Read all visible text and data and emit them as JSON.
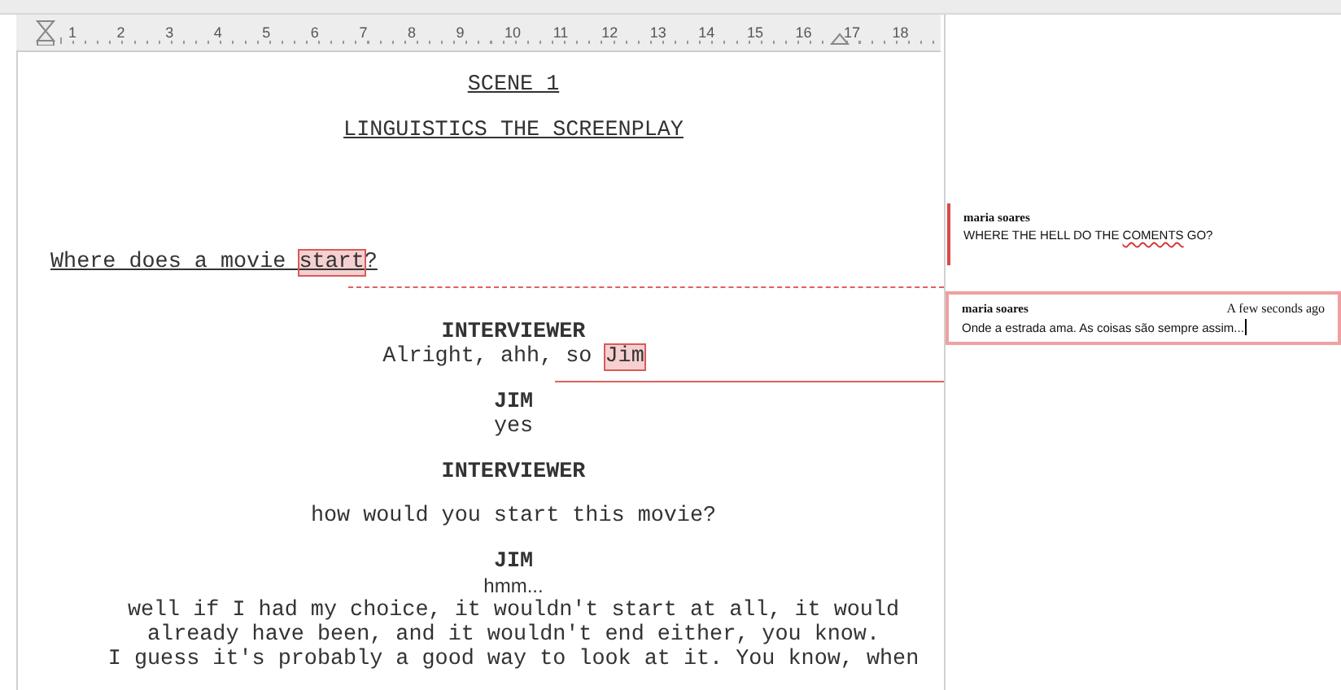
{
  "ruler": {
    "numbers": [
      "1",
      "2",
      "3",
      "4",
      "5",
      "6",
      "7",
      "8",
      "9",
      "10",
      "11",
      "12",
      "13",
      "14",
      "15",
      "16",
      "17",
      "18"
    ]
  },
  "script": [
    {
      "kind": "heading",
      "parts": [
        {
          "text": "SCENE 1"
        }
      ]
    },
    {
      "kind": "heading",
      "parts": [
        {
          "text": "LINGUISTICS THE SCREENPLAY"
        }
      ]
    },
    {
      "kind": "action",
      "parts": [
        {
          "text": "Where does a movie "
        },
        {
          "text": "start",
          "commented": true
        },
        {
          "text": "?"
        }
      ]
    },
    {
      "kind": "character",
      "parts": [
        {
          "text": "INTERVIEWER"
        }
      ]
    },
    {
      "kind": "dialogue",
      "parts": [
        {
          "text": "Alright, ahh, so "
        },
        {
          "text": "Jim",
          "commented": true
        }
      ]
    },
    {
      "kind": "character",
      "parts": [
        {
          "text": "JIM"
        }
      ]
    },
    {
      "kind": "dialogue",
      "parts": [
        {
          "text": "yes"
        }
      ]
    },
    {
      "kind": "character",
      "parts": [
        {
          "text": "INTERVIEWER"
        }
      ]
    },
    {
      "kind": "question",
      "parts": [
        {
          "text": "how would you start this movie?"
        }
      ]
    },
    {
      "kind": "character",
      "parts": [
        {
          "text": "JIM"
        }
      ]
    },
    {
      "kind": "note",
      "parts": [
        {
          "text": "hmm..."
        }
      ]
    },
    {
      "kind": "dialogue",
      "parts": [
        {
          "text": "well if I had my choice, it wouldn't start at all, it would"
        }
      ]
    },
    {
      "kind": "dialogue",
      "parts": [
        {
          "text": "already have been, and it wouldn't end either, you know."
        }
      ]
    },
    {
      "kind": "dialogue",
      "parts": [
        {
          "text": "I guess it's probably a good way to look at it. You know, when"
        }
      ]
    }
  ],
  "comments": [
    {
      "author": "maria soares",
      "parts": [
        {
          "text": "WHERE THE HELL DO THE "
        },
        {
          "text": "COMENTS",
          "misspelled": true
        },
        {
          "text": " GO?"
        }
      ],
      "selected": false
    },
    {
      "author": "maria soares",
      "time": "A few seconds ago",
      "parts": [
        {
          "text": "Onde a estrada ama. As coisas são sempre assim..."
        }
      ],
      "selected": true
    }
  ]
}
